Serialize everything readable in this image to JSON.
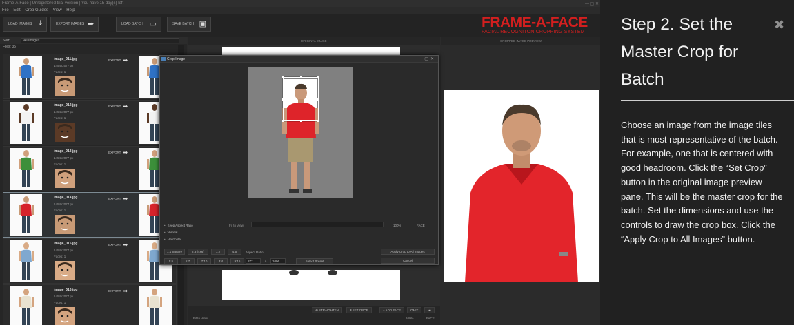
{
  "app": {
    "title": "Frame-A-Face | Unregistered trial version | You have 15 day(s) left",
    "menu": [
      "File",
      "Edit",
      "Crop Guides",
      "View",
      "Help"
    ],
    "toolbar": {
      "load_images": "LOAD IMAGES",
      "export_images": "EXPORT IMAGES",
      "load_batch": "LOAD BATCH",
      "save_batch": "SAVE BATCH"
    },
    "logo": {
      "name": "FRAME-A-FACE",
      "tagline": "FACIAL RECOGNITON CROPPING SYSTEM",
      "color": "#d21f1f"
    },
    "list": {
      "sort_label": "Sort:",
      "sort_value": "All Images",
      "files_label": "Files: 35",
      "tiles": [
        {
          "name": "Image_011.jpg",
          "dims": "1454x2077 px",
          "faces": "Faces: 1",
          "export": "EXPORT",
          "shirt": "#2f72c6",
          "skin": "#c89a76",
          "selected": false
        },
        {
          "name": "Image_012.jpg",
          "dims": "1454x2077 px",
          "faces": "Faces: 1",
          "export": "EXPORT",
          "shirt": "#f3f3f3",
          "skin": "#5b3a26",
          "selected": false
        },
        {
          "name": "Image_013.jpg",
          "dims": "1454x2077 px",
          "faces": "Faces: 1",
          "export": "EXPORT",
          "shirt": "#3c8f3a",
          "skin": "#d0a07c",
          "selected": false
        },
        {
          "name": "Image_014.jpg",
          "dims": "1454x2077 px",
          "faces": "Faces: 1",
          "export": "EXPORT",
          "shirt": "#d6232b",
          "skin": "#c89a76",
          "selected": true
        },
        {
          "name": "Image_015.jpg",
          "dims": "1454x2077 px",
          "faces": "Faces: 1",
          "export": "EXPORT",
          "shirt": "#7fa8cf",
          "skin": "#d9ab86",
          "selected": false
        },
        {
          "name": "Image_016.jpg",
          "dims": "1454x2077 px",
          "faces": "Faces: 1",
          "export": "EXPORT",
          "shirt": "#e8e2d0",
          "skin": "#d4a47f",
          "selected": false
        }
      ]
    },
    "panes": {
      "original": "ORIGINAL IMAGE",
      "preview": "CROPPED IMAGE PREVIEW",
      "fit_to_view": "Fit to View",
      "zoom": "100%",
      "face": "FACE",
      "straighten": "STRAIGHTEN",
      "set_crop": "SET CROP",
      "add_face": "+ ADD FACE",
      "omit": "OMIT",
      "more": "•••"
    },
    "crop_dialog": {
      "title": "Crop Image",
      "keep_aspect": "Keep Aspect Ratio",
      "vertical": "Vertical",
      "horizontal": "Horizontal",
      "fit_to_view": "Fit to View",
      "zoom": "100%",
      "face": "FACE",
      "ratios_row1": [
        "1:1 Square",
        "2:3 (4x6)",
        "1:2",
        "4:5"
      ],
      "ratios_row2": [
        "5:6",
        "5:7",
        "7:10",
        "3:4",
        "9:16"
      ],
      "aspect_label": "Aspect Ratio:",
      "aspect_w": "877",
      "aspect_x": "x",
      "aspect_h": "1096",
      "select_preset": "Select Preset",
      "apply_all": "Apply Crop to All Images",
      "cancel": "Cancel"
    }
  },
  "tutorial": {
    "title": "Step 2. Set the Master Crop for Batch",
    "body": "Choose an image from the image tiles that is most representative of the batch. For example, one that is centered with good headroom. Click the “Set Crop” button in the original image preview pane. This will be the master crop for the batch. Set the dimensions and use the controls to draw the crop box. Click the “Apply Crop to All Images” button."
  }
}
